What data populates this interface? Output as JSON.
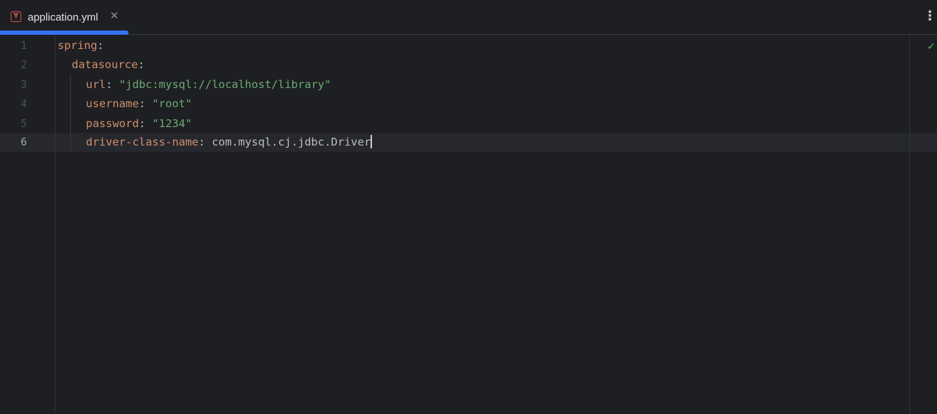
{
  "tab": {
    "icon": "yaml-file-icon",
    "icon_letter": "Y",
    "label": "application.yml",
    "close_glyph": "✕"
  },
  "toolbar": {
    "more_glyph": "⋮"
  },
  "inspection": {
    "status_icon": "check-icon",
    "glyph": "✓"
  },
  "editor": {
    "current_line": 6,
    "lines": [
      {
        "num": "1",
        "key": "spring",
        "sep": ":",
        "value": "",
        "value_type": ""
      },
      {
        "num": "2",
        "key": "datasource",
        "sep": ":",
        "value": "",
        "value_type": ""
      },
      {
        "num": "3",
        "key": "url",
        "sep": ": ",
        "value": "\"jdbc:mysql://localhost/library\"",
        "value_type": "string"
      },
      {
        "num": "4",
        "key": "username",
        "sep": ": ",
        "value": "\"root\"",
        "value_type": "string"
      },
      {
        "num": "5",
        "key": "password",
        "sep": ": ",
        "value": "\"1234\"",
        "value_type": "string"
      },
      {
        "num": "6",
        "key": "driver-class-name",
        "sep": ": ",
        "value": "com.mysql.cj.jdbc.Driver",
        "value_type": "plain"
      }
    ]
  },
  "colors": {
    "background": "#1e1f22",
    "key": "#cf8e6d",
    "string": "#6aab73",
    "plain": "#bcbec4",
    "accent": "#3574f0"
  }
}
